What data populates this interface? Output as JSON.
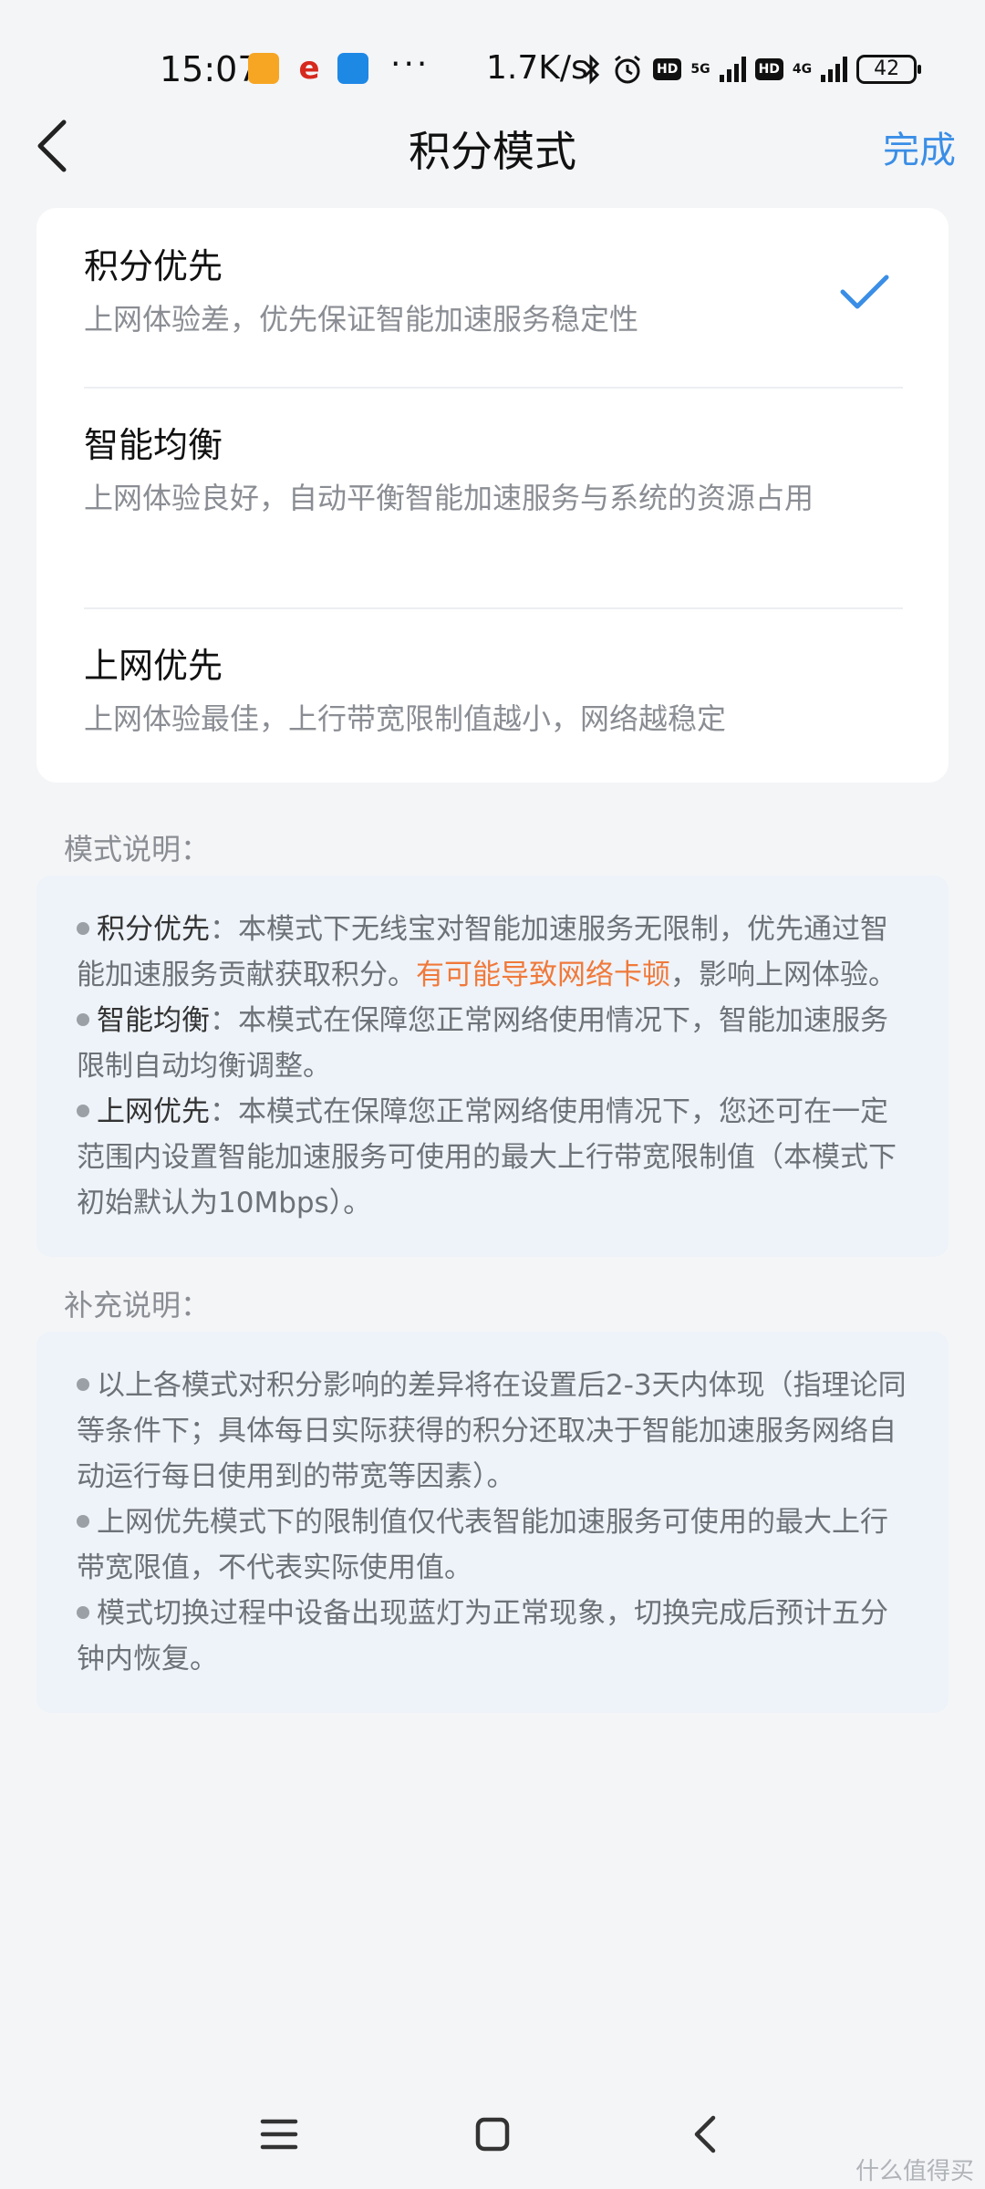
{
  "status_bar": {
    "time": "15:07",
    "more": "···",
    "speed": "1.7K/s",
    "hd": "HD",
    "net1": "5G",
    "net2": "4G",
    "battery": "42",
    "icons": [
      "notes-app-icon",
      "china-telecom-icon",
      "blue-app-icon",
      "bluetooth-icon",
      "alarm-icon",
      "signal-icon",
      "battery-icon"
    ]
  },
  "header": {
    "title": "积分模式",
    "done_label": "完成"
  },
  "options": [
    {
      "title": "积分优先",
      "desc": "上网体验差，优先保证智能加速服务稳定性",
      "selected": true
    },
    {
      "title": "智能均衡",
      "desc": "上网体验良好，自动平衡智能加速服务与系统的资源占用",
      "selected": false
    },
    {
      "title": "上网优先",
      "desc": "上网体验最佳，上行带宽限制值越小，网络越稳定",
      "selected": false
    }
  ],
  "mode_section": {
    "label": "模式说明：",
    "items": [
      {
        "term": "积分优先",
        "text1": "：本模式下无线宝对智能加速服务无限制，优先通过智能加速服务贡献获取积分。",
        "warn": "有可能导致网络卡顿",
        "text2": "，影响上网体验。"
      },
      {
        "term": "智能均衡",
        "text1": "：本模式在保障您正常网络使用情况下，智能加速服务限制自动均衡调整。"
      },
      {
        "term": "上网优先",
        "text1": "：本模式在保障您正常网络使用情况下，您还可在一定范围内设置智能加速服务可使用的最大上行带宽限制值（本模式下初始默认为10Mbps）。"
      }
    ]
  },
  "supp_section": {
    "label": "补充说明：",
    "items": [
      "以上各模式对积分影响的差异将在设置后2-3天内体现（指理论同等条件下；具体每日实际获得的积分还取决于智能加速服务网络自动运行每日使用到的带宽等因素）。",
      "上网优先模式下的限制值仅代表智能加速服务可使用的最大上行带宽限值，不代表实际使用值。",
      "模式切换过程中设备出现蓝灯为正常现象，切换完成后预计五分钟内恢复。"
    ]
  },
  "watermark": "什么值得买",
  "colors": {
    "accent": "#3a8ee6",
    "warning": "#f0793a",
    "info_bg": "#eef3f9"
  }
}
